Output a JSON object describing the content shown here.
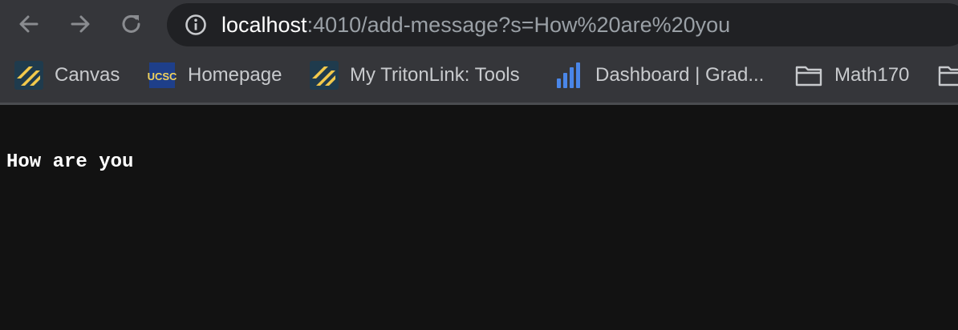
{
  "browser": {
    "url_host": "localhost",
    "url_rest": ":4010/add-message?s=How%20are%20you",
    "bookmarks": [
      {
        "label": "Canvas",
        "icon": "canvas-icon"
      },
      {
        "label": "Homepage",
        "icon": "ucsc-icon"
      },
      {
        "label": "My TritonLink: Tools",
        "icon": "tritonlink-icon"
      },
      {
        "label": "Dashboard | Grad...",
        "icon": "gradescope-chart-icon"
      },
      {
        "label": "Math170",
        "icon": "folder-icon"
      }
    ]
  },
  "page": {
    "message": "How are you"
  },
  "colors": {
    "toolbar_bg": "#35363a",
    "omnibox_bg": "#202124",
    "page_bg": "#121212",
    "text": "#ffffff",
    "accent_yellow": "#f2c94c",
    "chart_blue": "#4a86e8"
  }
}
